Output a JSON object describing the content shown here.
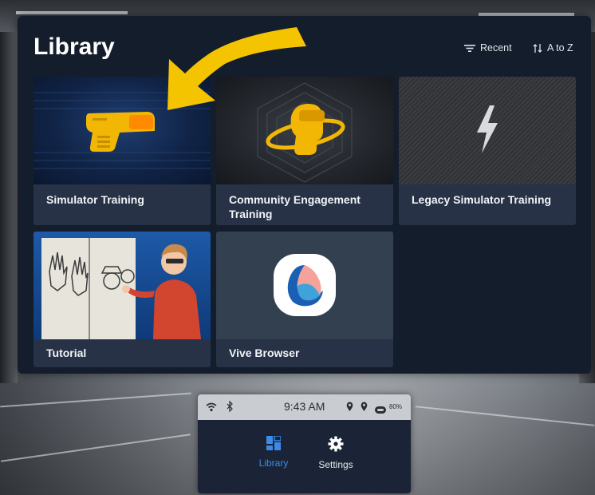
{
  "library": {
    "title": "Library",
    "sort_recent": "Recent",
    "sort_alpha": "A to Z",
    "tiles": [
      {
        "label": "Simulator Training"
      },
      {
        "label": "Community Engagement\nTraining"
      },
      {
        "label": "Legacy Simulator Training"
      },
      {
        "label": "Tutorial"
      },
      {
        "label": "Vive Browser"
      }
    ]
  },
  "taskbar": {
    "time": "9:43 AM",
    "battery": "80%",
    "nav": [
      {
        "label": "Library",
        "active": true
      },
      {
        "label": "Settings",
        "active": false
      }
    ]
  },
  "colors": {
    "panel_bg": "#141d2b",
    "tile_bg": "#273246",
    "accent_blue": "#3d8be8",
    "arrow_yellow": "#f5c400",
    "taser_yellow": "#f2b705"
  },
  "icons": [
    "sort-lines-icon",
    "sort-updown-icon",
    "taser-icon",
    "vr-headset-head-icon",
    "lightning-bolt-icon",
    "vive-browser-icon",
    "wifi-icon",
    "bluetooth-icon",
    "location-pin-icon",
    "battery-icon",
    "library-grid-icon",
    "settings-gear-icon"
  ]
}
